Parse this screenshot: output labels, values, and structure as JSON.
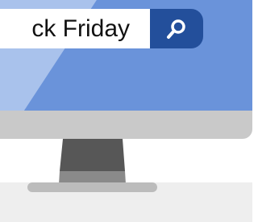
{
  "search": {
    "query_text": "ck Friday"
  },
  "icons": {
    "search_button_icon": "search-icon"
  },
  "colors": {
    "screen": "#8faee3",
    "screen_glare": "#a9c2ec",
    "search_button": "#234f9b",
    "search_field": "#ffffff",
    "monitor_chin": "#c9c9c9",
    "stand_neck": "#575757",
    "stand_neck_lower": "#8a8a8a",
    "stand_base": "#bcbcbc",
    "desk": "#eeeeee"
  }
}
